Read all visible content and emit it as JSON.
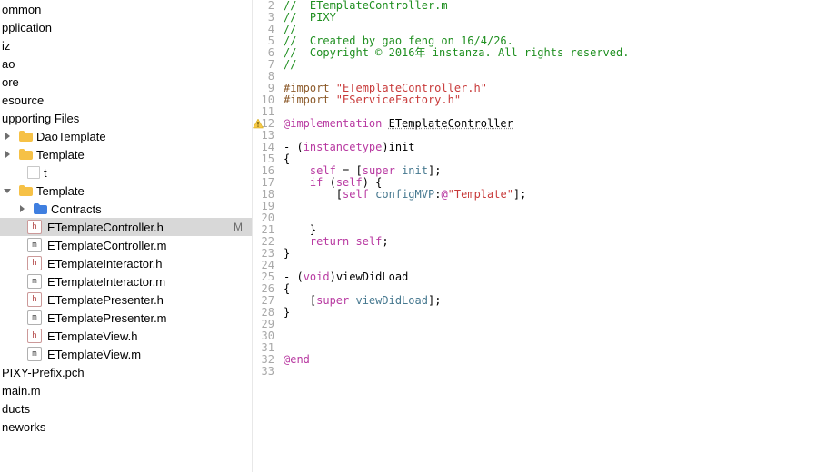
{
  "sidebar": {
    "items": [
      {
        "label": "ommon",
        "depth": 0,
        "kind": "text"
      },
      {
        "label": "pplication",
        "depth": 0,
        "kind": "text"
      },
      {
        "label": "iz",
        "depth": 0,
        "kind": "text"
      },
      {
        "label": "ao",
        "depth": 0,
        "kind": "text"
      },
      {
        "label": "ore",
        "depth": 0,
        "kind": "text"
      },
      {
        "label": "esource",
        "depth": 0,
        "kind": "text"
      },
      {
        "label": "upporting Files",
        "depth": 0,
        "kind": "text"
      },
      {
        "label": "DaoTemplate",
        "depth": 1,
        "kind": "folder",
        "open": false
      },
      {
        "label": "Template",
        "depth": 1,
        "kind": "folder",
        "open": false
      },
      {
        "label": "t",
        "depth": 2,
        "kind": "blank"
      },
      {
        "label": "Template",
        "depth": 1,
        "kind": "folder",
        "open": true
      },
      {
        "label": "Contracts",
        "depth": 2,
        "kind": "folder",
        "open": false
      },
      {
        "label": "ETemplateController.h",
        "depth": 2,
        "kind": "h",
        "selected": true,
        "status": "M"
      },
      {
        "label": "ETemplateController.m",
        "depth": 2,
        "kind": "m"
      },
      {
        "label": "ETemplateInteractor.h",
        "depth": 2,
        "kind": "h"
      },
      {
        "label": "ETemplateInteractor.m",
        "depth": 2,
        "kind": "m"
      },
      {
        "label": "ETemplatePresenter.h",
        "depth": 2,
        "kind": "h"
      },
      {
        "label": "ETemplatePresenter.m",
        "depth": 2,
        "kind": "m"
      },
      {
        "label": "ETemplateView.h",
        "depth": 2,
        "kind": "h"
      },
      {
        "label": "ETemplateView.m",
        "depth": 2,
        "kind": "m"
      },
      {
        "label": "PIXY-Prefix.pch",
        "depth": 1,
        "kind": "text"
      },
      {
        "label": "main.m",
        "depth": 1,
        "kind": "text"
      },
      {
        "label": "ducts",
        "depth": 0,
        "kind": "text"
      },
      {
        "label": "neworks",
        "depth": 0,
        "kind": "text"
      }
    ]
  },
  "editor": {
    "warning_line": 12,
    "lines": [
      {
        "n": 2,
        "segs": [
          [
            "c-comment",
            "//  ETemplateController.m"
          ]
        ]
      },
      {
        "n": 3,
        "segs": [
          [
            "c-comment",
            "//  PIXY"
          ]
        ]
      },
      {
        "n": 4,
        "segs": [
          [
            "c-comment",
            "//"
          ]
        ]
      },
      {
        "n": 5,
        "segs": [
          [
            "c-comment",
            "//  Created by gao feng on 16/4/26."
          ]
        ]
      },
      {
        "n": 6,
        "segs": [
          [
            "c-comment",
            "//  Copyright © 2016年 instanza. All rights reserved."
          ]
        ]
      },
      {
        "n": 7,
        "segs": [
          [
            "c-comment",
            "//"
          ]
        ]
      },
      {
        "n": 8,
        "segs": [
          [
            "",
            ""
          ]
        ]
      },
      {
        "n": 9,
        "segs": [
          [
            "c-import",
            "#import "
          ],
          [
            "c-string",
            "\"ETemplateController.h\""
          ]
        ]
      },
      {
        "n": 10,
        "segs": [
          [
            "c-import",
            "#import "
          ],
          [
            "c-string",
            "\"EServiceFactory.h\""
          ]
        ]
      },
      {
        "n": 11,
        "segs": [
          [
            "",
            ""
          ]
        ]
      },
      {
        "n": 12,
        "segs": [
          [
            "c-kw",
            "@implementation"
          ],
          [
            "",
            " "
          ],
          [
            "",
            "ETemplateController"
          ]
        ],
        "underline_last": true
      },
      {
        "n": 13,
        "segs": [
          [
            "",
            ""
          ]
        ]
      },
      {
        "n": 14,
        "segs": [
          [
            "",
            "- ("
          ],
          [
            "c-kw",
            "instancetype"
          ],
          [
            "",
            ")init"
          ]
        ]
      },
      {
        "n": 15,
        "segs": [
          [
            "",
            "{"
          ]
        ]
      },
      {
        "n": 16,
        "segs": [
          [
            "",
            "    "
          ],
          [
            "c-self",
            "self"
          ],
          [
            "",
            " = ["
          ],
          [
            "c-kw",
            "super"
          ],
          [
            "",
            " "
          ],
          [
            "c-msg",
            "init"
          ],
          [
            "",
            "];"
          ]
        ]
      },
      {
        "n": 17,
        "segs": [
          [
            "",
            "    "
          ],
          [
            "c-kw",
            "if"
          ],
          [
            "",
            " ("
          ],
          [
            "c-self",
            "self"
          ],
          [
            "",
            ") {"
          ]
        ]
      },
      {
        "n": 18,
        "segs": [
          [
            "",
            "        ["
          ],
          [
            "c-self",
            "self"
          ],
          [
            "",
            " "
          ],
          [
            "c-msg",
            "configMVP"
          ],
          [
            "",
            ":"
          ],
          [
            "c-kw",
            "@"
          ],
          [
            "c-atstr",
            "\"Template\""
          ],
          [
            "",
            "];"
          ]
        ]
      },
      {
        "n": 19,
        "segs": [
          [
            "",
            ""
          ]
        ]
      },
      {
        "n": 20,
        "segs": [
          [
            "",
            ""
          ]
        ]
      },
      {
        "n": 21,
        "segs": [
          [
            "",
            "    }"
          ]
        ]
      },
      {
        "n": 22,
        "segs": [
          [
            "",
            "    "
          ],
          [
            "c-kw",
            "return"
          ],
          [
            "",
            " "
          ],
          [
            "c-self",
            "self"
          ],
          [
            "",
            ";"
          ]
        ]
      },
      {
        "n": 23,
        "segs": [
          [
            "",
            "}"
          ]
        ]
      },
      {
        "n": 24,
        "segs": [
          [
            "",
            ""
          ]
        ]
      },
      {
        "n": 25,
        "segs": [
          [
            "",
            "- ("
          ],
          [
            "c-kw",
            "void"
          ],
          [
            "",
            ")viewDidLoad"
          ]
        ]
      },
      {
        "n": 26,
        "segs": [
          [
            "",
            "{"
          ]
        ]
      },
      {
        "n": 27,
        "segs": [
          [
            "",
            "    ["
          ],
          [
            "c-kw",
            "super"
          ],
          [
            "",
            " "
          ],
          [
            "c-msg",
            "viewDidLoad"
          ],
          [
            "",
            "];"
          ]
        ]
      },
      {
        "n": 28,
        "segs": [
          [
            "",
            "}"
          ]
        ]
      },
      {
        "n": 29,
        "segs": [
          [
            "",
            ""
          ]
        ]
      },
      {
        "n": 30,
        "segs": [
          [
            "",
            ""
          ]
        ],
        "caret": true
      },
      {
        "n": 31,
        "segs": [
          [
            "",
            ""
          ]
        ]
      },
      {
        "n": 32,
        "segs": [
          [
            "c-kw",
            "@end"
          ]
        ]
      },
      {
        "n": 33,
        "segs": [
          [
            "",
            ""
          ]
        ]
      }
    ]
  }
}
